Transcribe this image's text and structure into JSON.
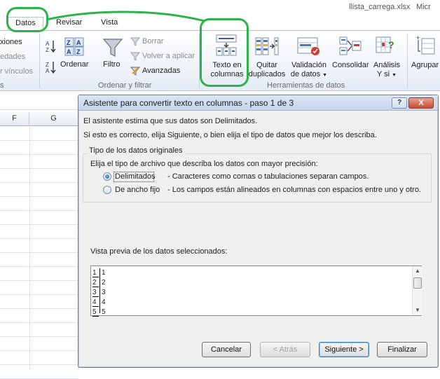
{
  "window": {
    "title": "llista_carrega.xlsx",
    "title_extra": "Micr"
  },
  "tabs": [
    {
      "label": "Datos",
      "active": true
    },
    {
      "label": "Revisar",
      "active": false
    },
    {
      "label": "Vista",
      "active": false
    }
  ],
  "ribbon": {
    "partial_left": [
      "xiones",
      "edades",
      "r vínculos"
    ],
    "partial_group_label": "s",
    "sort_group": {
      "az_label": "AZ",
      "za_label": "ZA",
      "ordenar": "Ordenar",
      "filtro": "Filtro",
      "borrar": "Borrar",
      "volver": "Volver a aplicar",
      "avanzadas": "Avanzadas",
      "group_label": "Ordenar y filtrar"
    },
    "tools_group": {
      "texto_line1": "Texto en",
      "texto_line2": "columnas",
      "quitar_line1": "Quitar",
      "quitar_line2": "duplicados",
      "validacion_line1": "Validación",
      "validacion_line2": "de datos",
      "consolidar": "Consolidar",
      "analisis_line1": "Análisis",
      "analisis_line2": "Y si",
      "group_label": "Herramientas de datos"
    },
    "partial_right": "Agrupar"
  },
  "sheet": {
    "columns": [
      "F",
      "G"
    ]
  },
  "dialog": {
    "title": "Asistente para convertir texto en columnas - paso 1 de 3",
    "help": "?",
    "close": "X",
    "line1": "El asistente estima que sus datos son Delimitados.",
    "line2": "Si esto es correcto, elija Siguiente, o bien elija el tipo de datos que mejor los describa.",
    "group_title": "Tipo de los datos originales",
    "group_prompt": "Elija el tipo de archivo que describa los datos con mayor precisión:",
    "options": [
      {
        "label": "Delimitados",
        "desc": "- Caracteres como comas o tabulaciones separan campos.",
        "selected": true
      },
      {
        "label": "De ancho fijo",
        "desc": "- Los campos están alineados en columnas con espacios entre uno y otro.",
        "selected": false
      }
    ],
    "preview_label": "Vista previa de los datos seleccionados:",
    "preview_rows": [
      {
        "num": "1",
        "val": "1"
      },
      {
        "num": "2",
        "val": "2"
      },
      {
        "num": "3",
        "val": "3"
      },
      {
        "num": "4",
        "val": "4"
      },
      {
        "num": "5",
        "val": "5"
      }
    ],
    "buttons": {
      "cancel": "Cancelar",
      "back": "< Atrás",
      "next": "Siguiente >",
      "finish": "Finalizar"
    }
  },
  "colors": {
    "highlight": "#2eb34a",
    "ribbon_border": "#b5c4d7",
    "dialog_bg": "#f0f0f0"
  }
}
